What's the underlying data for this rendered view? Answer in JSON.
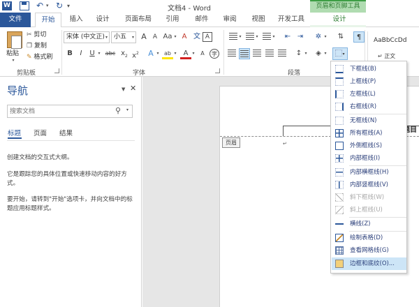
{
  "titlebar": {
    "app_icon": "W",
    "title": "文档4 - Word",
    "context_tool": "页眉和页脚工具"
  },
  "tabs": {
    "file": "文件",
    "home": "开始",
    "insert": "插入",
    "design": "设计",
    "layout": "页面布局",
    "references": "引用",
    "mailings": "邮件",
    "review": "审阅",
    "view": "视图",
    "developer": "开发工具",
    "hf_design": "设计"
  },
  "ribbon": {
    "clipboard": {
      "paste": "粘贴",
      "cut": "剪切",
      "copy": "复制",
      "format_painter": "格式刷",
      "label": "剪贴板"
    },
    "font": {
      "font_name": "宋体 (中文正)",
      "font_size": "小五",
      "grow": "A",
      "shrink": "A",
      "case": "Aa",
      "clear": "A",
      "phonetic": "文",
      "bold": "B",
      "italic": "I",
      "underline": "U",
      "strike": "abc",
      "sub": "x",
      "sup": "x",
      "effects": "A",
      "highlight": "ab",
      "color": "A",
      "enclose": "字",
      "label": "字体"
    },
    "paragraph": {
      "label": "段落"
    },
    "styles": {
      "sample": "AaBbCcDd",
      "name": "↵ 正文"
    }
  },
  "nav": {
    "title": "导航",
    "search_placeholder": "搜索文档",
    "tab_headings": "标题",
    "tab_pages": "页面",
    "tab_results": "结果",
    "p1": "创建文档的交互式大纲。",
    "p2": "它是跟踪您的具体位置或快速移动内容的好方式。",
    "p3": "要开始，请转到\"开始\"选项卡，并向文档中的标题应用标题样式。"
  },
  "document": {
    "header_tag": "页眉",
    "heading_fragment": "题目",
    "para_mark": "↵"
  },
  "border_menu": {
    "items": [
      {
        "label": "下框线(B)",
        "icon": "bottom-border-icon"
      },
      {
        "label": "上框线(P)",
        "icon": "top-border-icon"
      },
      {
        "label": "左框线(L)",
        "icon": "left-border-icon"
      },
      {
        "label": "右框线(R)",
        "icon": "right-border-icon"
      },
      {
        "label": "无框线(N)",
        "icon": "no-border-icon"
      },
      {
        "label": "所有框线(A)",
        "icon": "all-borders-icon"
      },
      {
        "label": "外侧框线(S)",
        "icon": "outside-borders-icon"
      },
      {
        "label": "内部框线(I)",
        "icon": "inside-borders-icon"
      },
      {
        "label": "内部横框线(H)",
        "icon": "inside-horizontal-border-icon"
      },
      {
        "label": "内部竖框线(V)",
        "icon": "inside-vertical-border-icon"
      },
      {
        "label": "斜下框线(W)",
        "icon": "diagonal-down-border-icon"
      },
      {
        "label": "斜上框线(U)",
        "icon": "diagonal-up-border-icon"
      },
      {
        "label": "横线(Z)",
        "icon": "horizontal-line-icon"
      },
      {
        "label": "绘制表格(D)",
        "icon": "draw-table-icon"
      },
      {
        "label": "查看网格线(G)",
        "icon": "view-gridlines-icon"
      },
      {
        "label": "边框和底纹(O)...",
        "icon": "borders-shading-icon"
      }
    ]
  }
}
